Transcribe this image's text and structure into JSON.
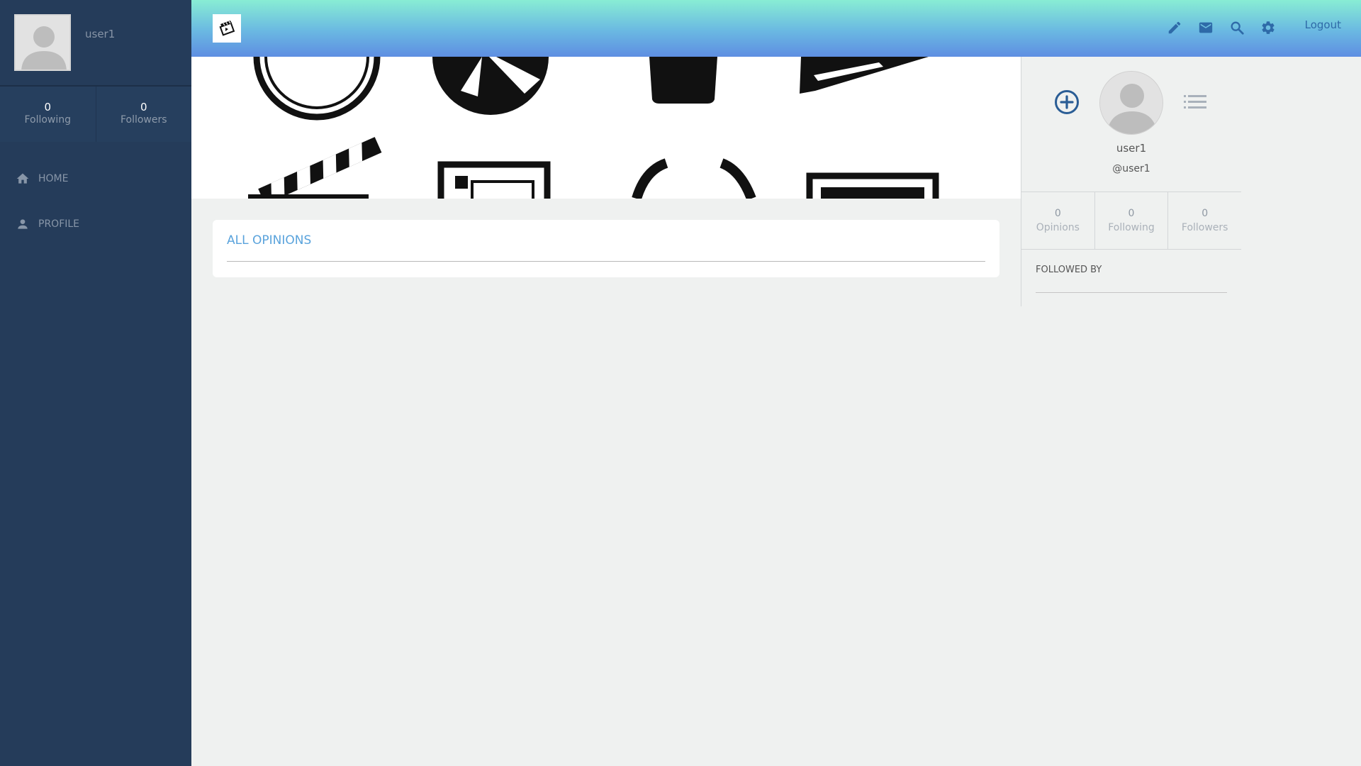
{
  "sidebar": {
    "username": "user1",
    "stats": [
      {
        "count": "0",
        "label": "Following"
      },
      {
        "count": "0",
        "label": "Followers"
      }
    ],
    "nav": [
      {
        "label": "HOME",
        "icon": "home-icon"
      },
      {
        "label": "PROFILE",
        "icon": "person-icon"
      }
    ]
  },
  "header": {
    "icons": [
      "pencil-icon",
      "mail-icon",
      "search-icon",
      "gear-icon"
    ],
    "logout_label": "Logout",
    "colors": {
      "gradient_top": "#88edd4",
      "gradient_bottom": "#5e8ee2",
      "icon": "#2e6aa8"
    }
  },
  "main": {
    "opinions_title": "ALL OPINIONS"
  },
  "profile_panel": {
    "name": "user1",
    "handle": "@user1",
    "stats": [
      {
        "count": "0",
        "label": "Opinions"
      },
      {
        "count": "0",
        "label": "Following"
      },
      {
        "count": "0",
        "label": "Followers"
      }
    ],
    "followed_by_title": "FOLLOWED BY"
  },
  "colors": {
    "sidebar": "#253c5a",
    "page_bg": "#eff1f0",
    "accent": "#5aa3dc"
  }
}
